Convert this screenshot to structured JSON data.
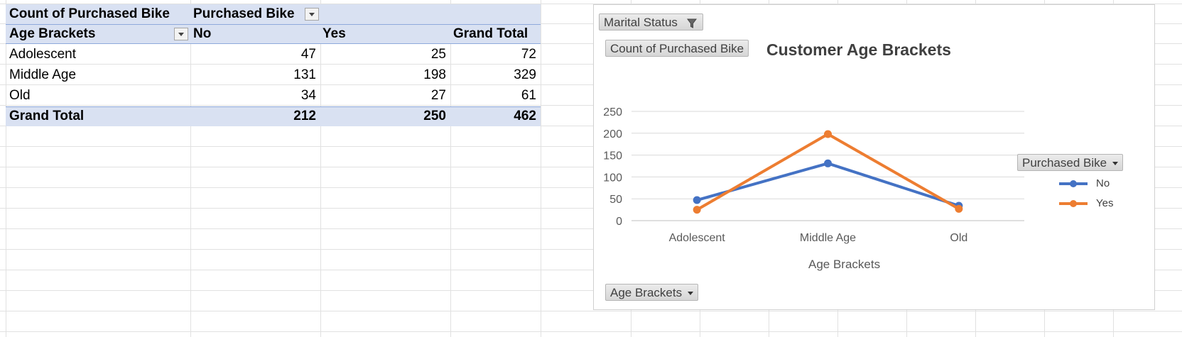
{
  "pivot": {
    "values_field": "Count of Purchased Bike",
    "column_field": "Purchased Bike",
    "row_field": "Age Brackets",
    "columns": [
      "No",
      "Yes",
      "Grand Total"
    ],
    "rows": [
      {
        "label": "Adolescent",
        "no": "47",
        "yes": "25",
        "total": "72"
      },
      {
        "label": "Middle Age",
        "no": "131",
        "yes": "198",
        "total": "329"
      },
      {
        "label": "Old",
        "no": "34",
        "yes": "27",
        "total": "61"
      }
    ],
    "grand_total": {
      "label": "Grand Total",
      "no": "212",
      "yes": "250",
      "total": "462"
    }
  },
  "chart_buttons": {
    "filter": "Marital Status",
    "values": "Count of Purchased Bike",
    "axis": "Age Brackets",
    "legend": "Purchased Bike"
  },
  "chart_data": {
    "type": "line",
    "title": "Customer Age Brackets",
    "xlabel": "Age Brackets",
    "ylabel": "",
    "categories": [
      "Adolescent",
      "Middle Age",
      "Old"
    ],
    "ylim": [
      0,
      250
    ],
    "yticks": [
      0,
      50,
      100,
      150,
      200,
      250
    ],
    "grid": true,
    "legend_position": "right",
    "series": [
      {
        "name": "No",
        "values": [
          47,
          131,
          34
        ],
        "color": "#4472c4"
      },
      {
        "name": "Yes",
        "values": [
          25,
          198,
          27
        ],
        "color": "#ed7d31"
      }
    ]
  }
}
